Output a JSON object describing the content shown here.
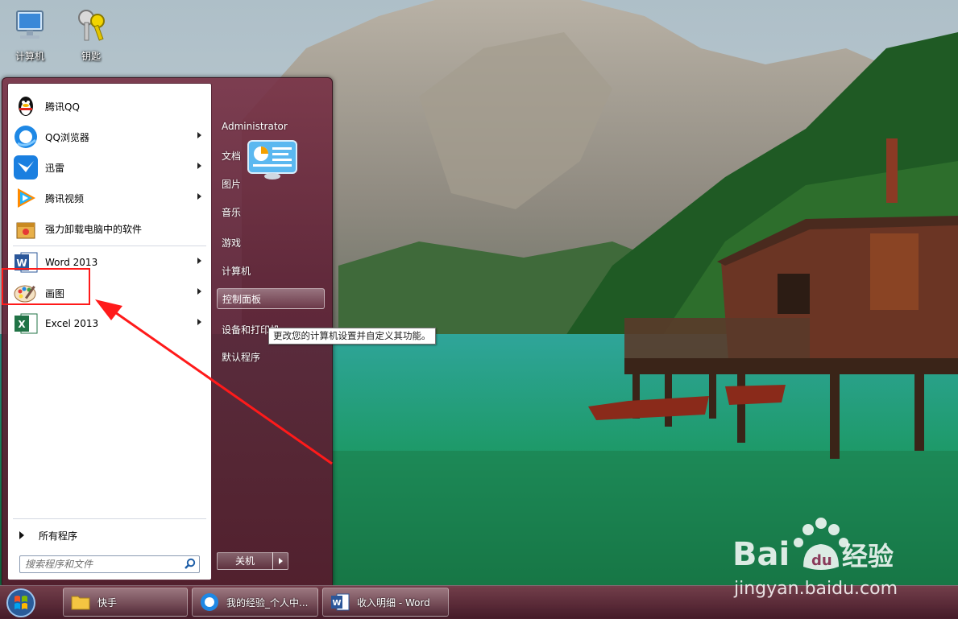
{
  "desktop": {
    "icons": [
      {
        "label": "计算机",
        "icon": "computer-icon"
      },
      {
        "label": "钥匙",
        "icon": "keys-icon"
      }
    ]
  },
  "start_menu": {
    "programs": [
      {
        "label": "腾讯QQ",
        "icon": "qq-penguin-icon",
        "has_submenu": false
      },
      {
        "label": "QQ浏览器",
        "icon": "qq-browser-icon",
        "has_submenu": true
      },
      {
        "label": "迅雷",
        "icon": "xunlei-bird-icon",
        "has_submenu": true
      },
      {
        "label": "腾讯视频",
        "icon": "tencent-video-icon",
        "has_submenu": true
      },
      {
        "label": "强力卸载电脑中的软件",
        "icon": "uninstall-box-icon",
        "has_submenu": false
      },
      {
        "label": "Word 2013",
        "icon": "word-icon",
        "has_submenu": true
      },
      {
        "label": "画图",
        "icon": "paint-palette-icon",
        "has_submenu": true
      },
      {
        "label": "Excel 2013",
        "icon": "excel-icon",
        "has_submenu": true
      }
    ],
    "all_programs_label": "所有程序",
    "search_placeholder": "搜索程序和文件",
    "right_items": {
      "user": "Administrator",
      "documents": "文档",
      "pictures": "图片",
      "music": "音乐",
      "games": "游戏",
      "computer": "计算机",
      "control_panel": "控制面板",
      "devices_printers": "设备和打印机",
      "default_programs": "默认程序"
    },
    "tooltip": "更改您的计算机设置并自定义其功能。",
    "shutdown_label": "关机"
  },
  "taskbar": {
    "buttons": [
      {
        "label": "快手",
        "icon": "folder-icon"
      },
      {
        "label": "我的经验_个人中...",
        "icon": "qq-browser-icon"
      },
      {
        "label": "收入明细 - Word",
        "icon": "word-icon"
      }
    ]
  },
  "watermark": {
    "brand_left": "Bai",
    "brand_right": "经验",
    "url": "jingyan.baidu.com"
  },
  "colors": {
    "annotation_red": "#ff1a1a",
    "menu_bg": "#6b2a40"
  }
}
